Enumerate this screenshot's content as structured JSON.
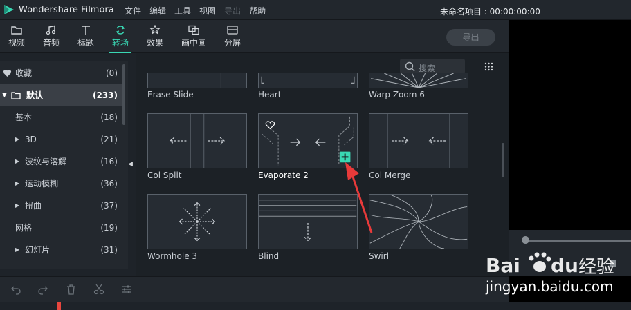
{
  "app": {
    "title": "Wondershare Filmora",
    "project": "未命名项目 : 00:00:00:00"
  },
  "menu": [
    {
      "label": "文件",
      "disabled": false
    },
    {
      "label": "编辑",
      "disabled": false
    },
    {
      "label": "工具",
      "disabled": false
    },
    {
      "label": "视图",
      "disabled": false
    },
    {
      "label": "导出",
      "disabled": true
    },
    {
      "label": "帮助",
      "disabled": false
    }
  ],
  "tabs": [
    {
      "label": "视频",
      "icon": "folder-icon"
    },
    {
      "label": "音频",
      "icon": "music-note-icon"
    },
    {
      "label": "标题",
      "icon": "text-icon"
    },
    {
      "label": "转场",
      "icon": "transition-icon",
      "active": true
    },
    {
      "label": "效果",
      "icon": "effects-icon"
    },
    {
      "label": "画中画",
      "icon": "pip-icon"
    },
    {
      "label": "分屏",
      "icon": "split-screen-icon"
    }
  ],
  "export_button": "导出",
  "sidebar": {
    "items": [
      {
        "label": "收藏",
        "count": "(0)",
        "icon": "heart-icon"
      },
      {
        "label": "默认",
        "count": "(233)",
        "icon": "folder-icon",
        "active": true
      },
      {
        "label": "基本",
        "count": "(18)"
      },
      {
        "label": "3D",
        "count": "(21)",
        "expandable": true
      },
      {
        "label": "波纹与溶解",
        "count": "(16)",
        "expandable": true
      },
      {
        "label": "运动模糊",
        "count": "(36)",
        "expandable": true
      },
      {
        "label": "扭曲",
        "count": "(37)",
        "expandable": true
      },
      {
        "label": "网格",
        "count": "(19)"
      },
      {
        "label": "幻灯片",
        "count": "(31)",
        "expandable": true
      }
    ]
  },
  "search": {
    "placeholder": "搜索"
  },
  "transitions": [
    {
      "name": "Erase Slide"
    },
    {
      "name": "Heart"
    },
    {
      "name": "Warp Zoom 6"
    },
    {
      "name": "Col Split"
    },
    {
      "name": "Evaporate 2",
      "selected": true
    },
    {
      "name": "Col Merge"
    },
    {
      "name": "Wormhole 3"
    },
    {
      "name": "Blind"
    },
    {
      "name": "Swirl"
    }
  ],
  "bottom_toolbar": [
    "undo-icon",
    "redo-icon",
    "delete-icon",
    "cut-icon",
    "adjust-icon"
  ],
  "watermark": {
    "text": "jingyan.baidu.com",
    "logo_text": "Bai du 经验"
  },
  "colors": {
    "accent": "#39d8b4",
    "annotation": "#e83a3a",
    "background": "#1e2329"
  }
}
